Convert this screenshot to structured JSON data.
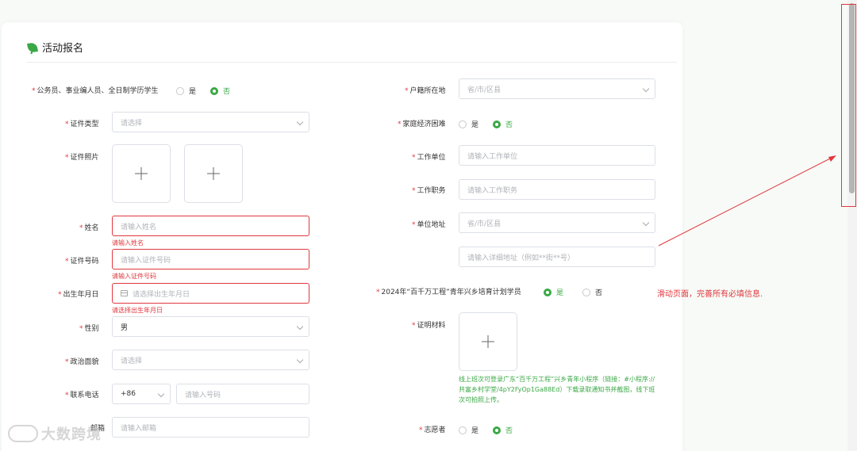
{
  "page": {
    "title": "活动报名"
  },
  "colors": {
    "accent": "#3aa845",
    "error": "#e0383e"
  },
  "radio_options": {
    "yes": "是",
    "no": "否"
  },
  "left": {
    "civil_servant": {
      "label": "公务员、事业编人员、全日制学历学生",
      "selected": "否"
    },
    "id_type": {
      "label": "证件类型",
      "placeholder": "请选择"
    },
    "id_photo": {
      "label": "证件照片"
    },
    "name": {
      "label": "姓名",
      "placeholder": "请输入姓名",
      "error": "请输入姓名"
    },
    "id_number": {
      "label": "证件号码",
      "placeholder": "请输入证件号码",
      "error": "请输入证件号码"
    },
    "birth_date": {
      "label": "出生年月日",
      "placeholder": "请选择出生年月日",
      "error": "请选择出生年月日"
    },
    "gender": {
      "label": "性别",
      "value": "男"
    },
    "political_status": {
      "label": "政治面貌",
      "placeholder": "请选择"
    },
    "phone": {
      "label": "联系电话",
      "code": "+86",
      "placeholder": "请输入号码"
    },
    "email": {
      "label": "邮箱",
      "placeholder": "请输入邮箱"
    }
  },
  "right": {
    "household": {
      "label": "户籍所在地",
      "placeholder": "省/市/区县"
    },
    "economic_hardship": {
      "label": "家庭经济困难",
      "selected": "否"
    },
    "work_unit": {
      "label": "工作单位",
      "placeholder": "请输入工作单位"
    },
    "job_title": {
      "label": "工作职务",
      "placeholder": "请输入工作职务"
    },
    "unit_address": {
      "label": "单位地址",
      "placeholder": "省/市/区县",
      "detail_placeholder": "请输入详细地址（例如**街**号）"
    },
    "program_2024": {
      "label": "2024年“百千万工程”青年兴乡培育计划学员",
      "selected": "是"
    },
    "proof": {
      "label": "证明材料",
      "hint": "线上班次可登录广东“百千万工程”兴乡青年小程序（链接：#小程序://共富乡村学堂/4pY2FyOp1Ga88Ed）下载录取通知书并截图，线下班次可拍照上传。"
    },
    "volunteer": {
      "label": "志愿者",
      "selected": "否"
    }
  },
  "annotation": {
    "text": "滑动页面，完善所有必填信息."
  },
  "watermark": {
    "text": "大数跨境"
  }
}
